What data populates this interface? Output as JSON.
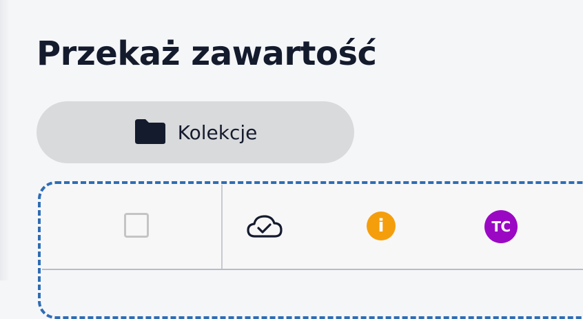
{
  "page": {
    "title": "Przekaż zawartość"
  },
  "collections_button": {
    "icon": "folder-icon",
    "label": "Kolekcje"
  },
  "toolbar": {
    "checkbox": {
      "checked": false
    },
    "sync_status_icon": "cloud-check-icon",
    "info_badge": {
      "icon": "info-icon",
      "label": "i",
      "color": "#f59e0b"
    },
    "avatar": {
      "initials": "TC",
      "color": "#9b08c4"
    }
  },
  "colors": {
    "title": "#141b2d",
    "button_bg": "#d9dadc",
    "dashed_border": "#2e6db4",
    "background": "#f5f6f8"
  }
}
